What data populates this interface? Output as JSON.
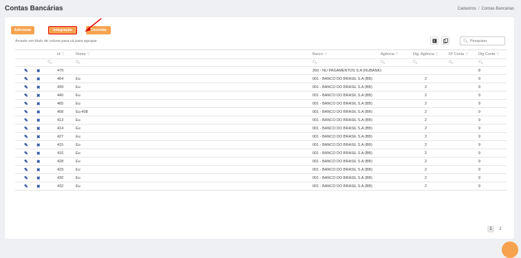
{
  "page": {
    "title": "Contas Bancárias",
    "breadcrumb": [
      "Cadastros",
      "Contas Bancárias"
    ],
    "breadcrumb_sep": "/"
  },
  "toolbar": {
    "add_label": "Adicionar",
    "integration_label": "Integração",
    "invite_label": "Convidar",
    "group_hint": "Arraste um título de coluna para cá para agrupar",
    "search_placeholder": "Pesquisar",
    "export_icon": "excel-export-icon",
    "columns_icon": "column-chooser-icon"
  },
  "grid": {
    "columns": {
      "id": "Id",
      "nome": "Nome",
      "banco": "Banco",
      "agencia": "Agência",
      "dig_agencia": "Dig. Agência",
      "num_conta": "Nº Conta",
      "dig_conta": "Dig Conta"
    },
    "rows": [
      {
        "id": "479",
        "nome": "",
        "banco": "260 - NU PAGAMENTOS S.A (NUBANK)",
        "agencia": "",
        "dig_agencia": "",
        "num_conta": "",
        "dig_conta": "8"
      },
      {
        "id": "464",
        "nome": "Eu",
        "banco": "001 - BANCO DO BRASIL S.A (BB)",
        "agencia": "",
        "dig_agencia": "2",
        "num_conta": "",
        "dig_conta": "9"
      },
      {
        "id": "439",
        "nome": "Eu",
        "banco": "001 - BANCO DO BRASIL S.A (BB)",
        "agencia": "",
        "dig_agencia": "2",
        "num_conta": "",
        "dig_conta": "9"
      },
      {
        "id": "440",
        "nome": "Eu",
        "banco": "001 - BANCO DO BRASIL S.A (BB)",
        "agencia": "",
        "dig_agencia": "2",
        "num_conta": "",
        "dig_conta": "9"
      },
      {
        "id": "465",
        "nome": "Eu",
        "banco": "001 - BANCO DO BRASIL S.A (BB)",
        "agencia": "",
        "dig_agencia": "2",
        "num_conta": "",
        "dig_conta": "9"
      },
      {
        "id": "408",
        "nome": "Eu-408",
        "banco": "001 - BANCO DO BRASIL S.A (BB)",
        "agencia": "",
        "dig_agencia": "2",
        "num_conta": "",
        "dig_conta": "9"
      },
      {
        "id": "413",
        "nome": "Eu",
        "banco": "001 - BANCO DO BRASIL S.A (BB)",
        "agencia": "",
        "dig_agencia": "2",
        "num_conta": "",
        "dig_conta": "9"
      },
      {
        "id": "414",
        "nome": "Eu",
        "banco": "001 - BANCO DO BRASIL S.A (BB)",
        "agencia": "",
        "dig_agencia": "2",
        "num_conta": "",
        "dig_conta": "9"
      },
      {
        "id": "427",
        "nome": "Eu",
        "banco": "001 - BANCO DO BRASIL S.A (BB)",
        "agencia": "",
        "dig_agencia": "2",
        "num_conta": "",
        "dig_conta": "9"
      },
      {
        "id": "415",
        "nome": "Eu",
        "banco": "001 - BANCO DO BRASIL S.A (BB)",
        "agencia": "",
        "dig_agencia": "2",
        "num_conta": "",
        "dig_conta": "9"
      },
      {
        "id": "416",
        "nome": "Eu",
        "banco": "001 - BANCO DO BRASIL S.A (BB)",
        "agencia": "",
        "dig_agencia": "2",
        "num_conta": "",
        "dig_conta": "9"
      },
      {
        "id": "428",
        "nome": "Eu",
        "banco": "001 - BANCO DO BRASIL S.A (BB)",
        "agencia": "",
        "dig_agencia": "2",
        "num_conta": "",
        "dig_conta": "9"
      },
      {
        "id": "429",
        "nome": "Eu",
        "banco": "001 - BANCO DO BRASIL S.A (BB)",
        "agencia": "",
        "dig_agencia": "2",
        "num_conta": "",
        "dig_conta": "9"
      },
      {
        "id": "430",
        "nome": "Eu",
        "banco": "001 - BANCO DO BRASIL S.A (BB)",
        "agencia": "",
        "dig_agencia": "2",
        "num_conta": "",
        "dig_conta": "9"
      },
      {
        "id": "432",
        "nome": "Eu",
        "banco": "001 - BANCO DO BRASIL S.A (BB)",
        "agencia": "",
        "dig_agencia": "2",
        "num_conta": "",
        "dig_conta": "9"
      }
    ],
    "row_icons": {
      "edit": "pencil-icon",
      "delete": "close-icon"
    }
  },
  "pagination": {
    "pages": [
      "1",
      "2"
    ],
    "current": "1"
  },
  "colors": {
    "accent": "#f7a24f",
    "highlight_border": "#e00000",
    "action_icon": "#2a4ca6"
  }
}
